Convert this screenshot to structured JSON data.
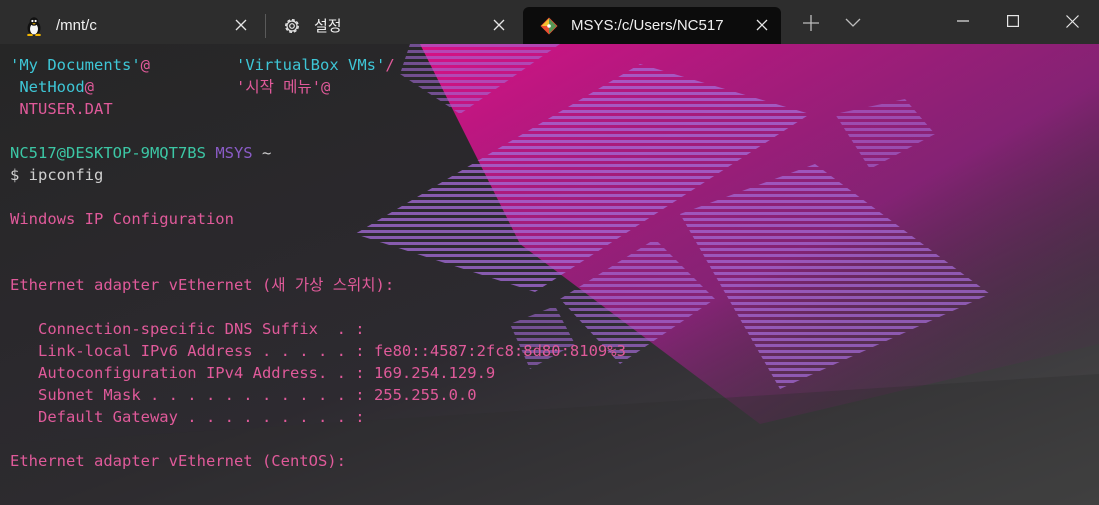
{
  "tabs": [
    {
      "title": "/mnt/c",
      "icon": "linux-penguin-icon"
    },
    {
      "title": "설정",
      "icon": "gear-icon"
    },
    {
      "title": "MSYS:/c/Users/NC517",
      "icon": "git-diamond-icon"
    }
  ],
  "titlebar": {
    "new_tab": "+",
    "dropdown_icon": "chevron-down-icon"
  },
  "terminal": {
    "ls": [
      {
        "col1": "'My Documents'",
        "col1_suffix": "@",
        "col2": "'VirtualBox VMs'",
        "col2_suffix": "/"
      },
      {
        "col1": " NetHood",
        "col1_suffix": "@",
        "col2": "'시작 메뉴'",
        "col2_suffix": "@"
      },
      {
        "col1": " NTUSER.DAT"
      }
    ],
    "prompt_user": "NC517@DESKTOP-9MQT7BS",
    "prompt_env": "MSYS",
    "prompt_dir": "~",
    "command": "$ ipconfig",
    "output": {
      "header": "Windows IP Configuration",
      "adapter1": "Ethernet adapter vEthernet (새 가상 스위치):",
      "rows": [
        "   Connection-specific DNS Suffix  . :",
        "   Link-local IPv6 Address . . . . . : fe80::4587:2fc8:8d80:8109%3",
        "   Autoconfiguration IPv4 Address. . : 169.254.129.9",
        "   Subnet Mask . . . . . . . . . . . : 255.255.0.0",
        "   Default Gateway . . . . . . . . . :"
      ],
      "adapter2": "Ethernet adapter vEthernet (CentOS):"
    }
  },
  "colors": {
    "accent_pink": "#e05a9a",
    "accent_cyan": "#3ec6d6",
    "prompt_green": "#3cc7a5",
    "prompt_purple": "#8a5cc6"
  }
}
